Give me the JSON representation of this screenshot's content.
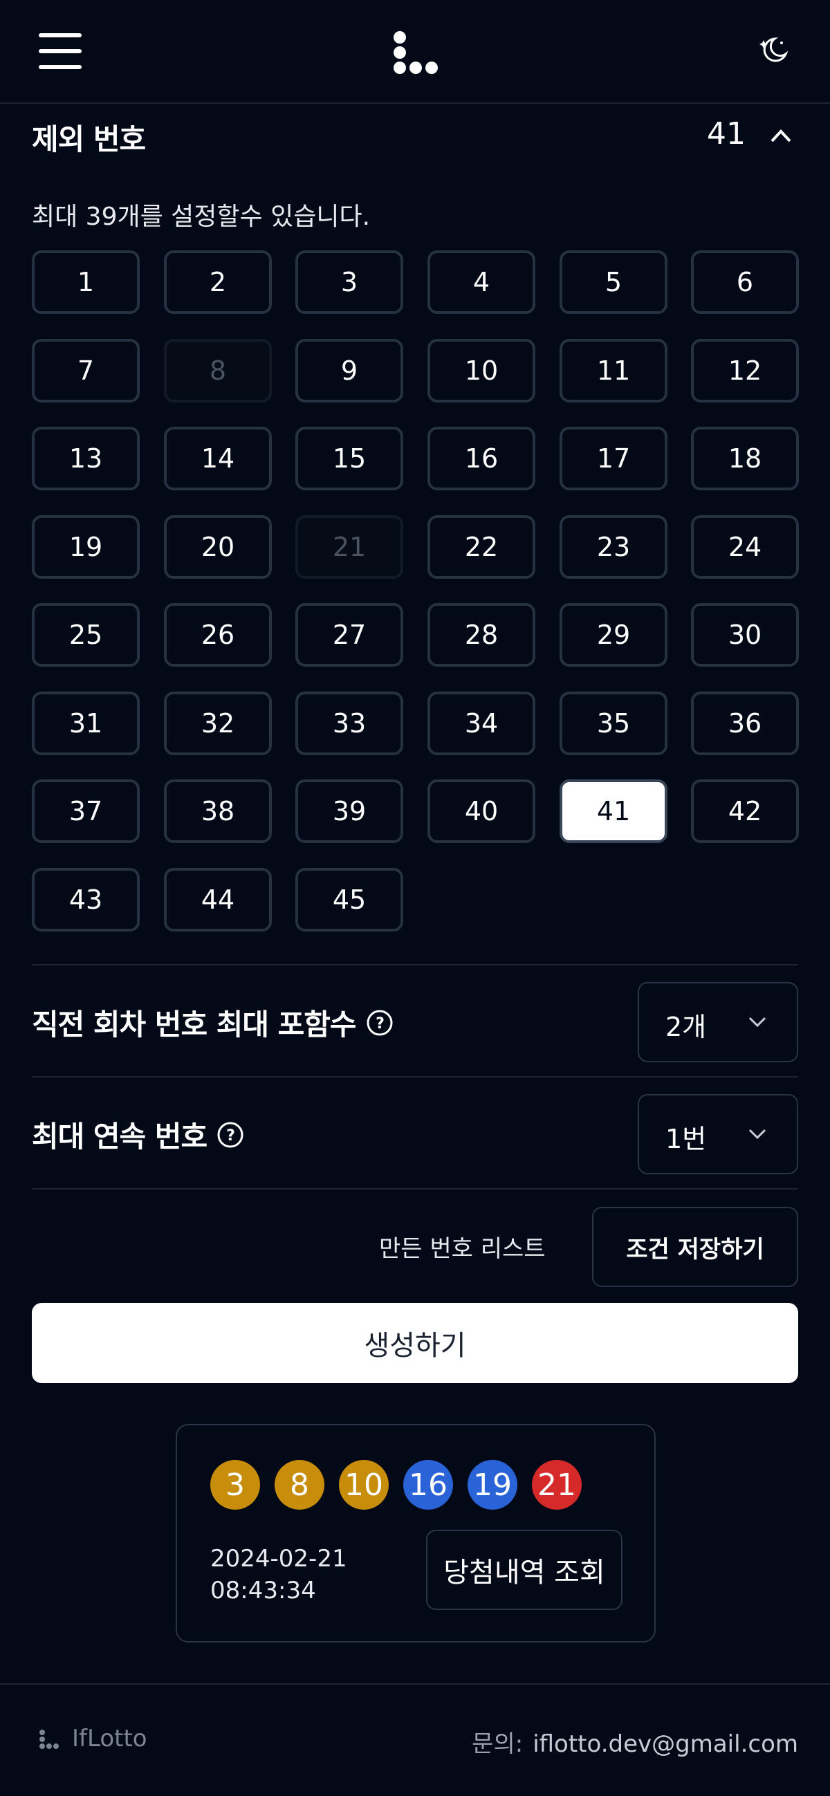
{
  "header": {
    "menu_icon": "hamburger-icon",
    "logo_icon": "dots-logo-icon",
    "theme_icon": "moon-stars-icon"
  },
  "excluded": {
    "title": "제외 번호",
    "value": "41",
    "hint": "최대 39개를 설정할수 있습니다.",
    "numbers": [
      "1",
      "2",
      "3",
      "4",
      "5",
      "6",
      "7",
      "8",
      "9",
      "10",
      "11",
      "12",
      "13",
      "14",
      "15",
      "16",
      "17",
      "18",
      "19",
      "20",
      "21",
      "22",
      "23",
      "24",
      "25",
      "26",
      "27",
      "28",
      "29",
      "30",
      "31",
      "32",
      "33",
      "34",
      "35",
      "36",
      "37",
      "38",
      "39",
      "40",
      "41",
      "42",
      "43",
      "44",
      "45"
    ],
    "disabled": [
      "8",
      "21"
    ],
    "selected": [
      "41"
    ]
  },
  "options": {
    "prev_round": {
      "label": "직전 회차 번호 최대 포함수",
      "value": "2개"
    },
    "consecutive": {
      "label": "최대 연속 번호",
      "value": "1번"
    }
  },
  "actions": {
    "list_link": "만든 번호 리스트",
    "save_label": "조건 저장하기",
    "generate_label": "생성하기"
  },
  "result": {
    "balls": [
      {
        "num": "3",
        "color": "yellow"
      },
      {
        "num": "8",
        "color": "yellow"
      },
      {
        "num": "10",
        "color": "yellow"
      },
      {
        "num": "16",
        "color": "blue"
      },
      {
        "num": "19",
        "color": "blue"
      },
      {
        "num": "21",
        "color": "red"
      }
    ],
    "date": "2024-02-21",
    "time": "08:43:34",
    "history_label": "당첨내역 조회"
  },
  "footer": {
    "brand": "IfLotto",
    "contact_label": "문의:",
    "email": "iflotto.dev@gmail.com"
  },
  "colors": {
    "background": "#030916",
    "border": "#263142",
    "ball_yellow": "#c88d0b",
    "ball_blue": "#2a62d8",
    "ball_red": "#d62a2a"
  }
}
